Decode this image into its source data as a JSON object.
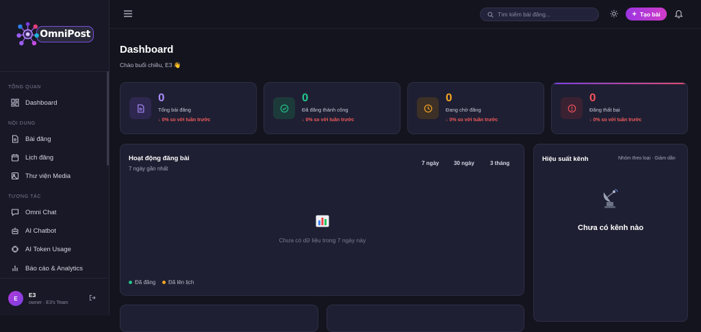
{
  "app": {
    "logo_text": "OmniPost"
  },
  "sidebar": {
    "sections": [
      {
        "title": "TỔNG QUAN"
      },
      {
        "title": "NỘI DUNG"
      },
      {
        "title": "TƯƠNG TÁC"
      }
    ],
    "items": [
      {
        "label": "Dashboard",
        "icon": "dashboard-grid-icon"
      },
      {
        "label": "Bài đăng",
        "icon": "document-icon"
      },
      {
        "label": "Lịch đăng",
        "icon": "calendar-icon"
      },
      {
        "label": "Thư viện Media",
        "icon": "image-icon"
      },
      {
        "label": "Omni Chat",
        "icon": "chat-icon"
      },
      {
        "label": "AI Chatbot",
        "icon": "robot-icon"
      },
      {
        "label": "AI Token Usage",
        "icon": "chip-icon"
      },
      {
        "label": "Báo cáo & Analytics",
        "icon": "bar-chart-icon"
      }
    ],
    "user": {
      "initial": "E",
      "name": "E3",
      "role": "owner · E3's Team"
    }
  },
  "topbar": {
    "search_placeholder": "Tìm kiếm bài đăng...",
    "create_label": "Tạo bài"
  },
  "page": {
    "title": "Dashboard",
    "greeting": "Chào buổi chiều, E3 👋"
  },
  "stats": [
    {
      "value": "0",
      "label": "Tổng bài đăng",
      "change": "↓ 0% so với tuần trước",
      "color": "#a78bfa"
    },
    {
      "value": "0",
      "label": "Đã đăng thành công",
      "change": "↓ 0% so với tuần trước",
      "color": "#22c58b"
    },
    {
      "value": "0",
      "label": "Đang chờ đăng",
      "change": "↓ 0% so với tuần trước",
      "color": "#f5a524"
    },
    {
      "value": "0",
      "label": "Đăng thất bại",
      "change": "↓ 0% so với tuần trước",
      "color": "#f0525a"
    }
  ],
  "activity": {
    "title": "Hoạt động đăng bài",
    "subtitle": "7 ngày gần nhất",
    "ranges": [
      "7 ngày",
      "30 ngày",
      "3 tháng"
    ],
    "empty_text": "Chưa có dữ liệu trong 7 ngày này",
    "legend": [
      {
        "label": "Đã đăng",
        "color": "#22c58b"
      },
      {
        "label": "Đã lên lịch",
        "color": "#f5a524"
      }
    ]
  },
  "channels": {
    "title": "Hiệu suất kênh",
    "sort_label": "Nhóm theo loại · Giảm dần",
    "empty_title": "Chưa có kênh nào"
  }
}
